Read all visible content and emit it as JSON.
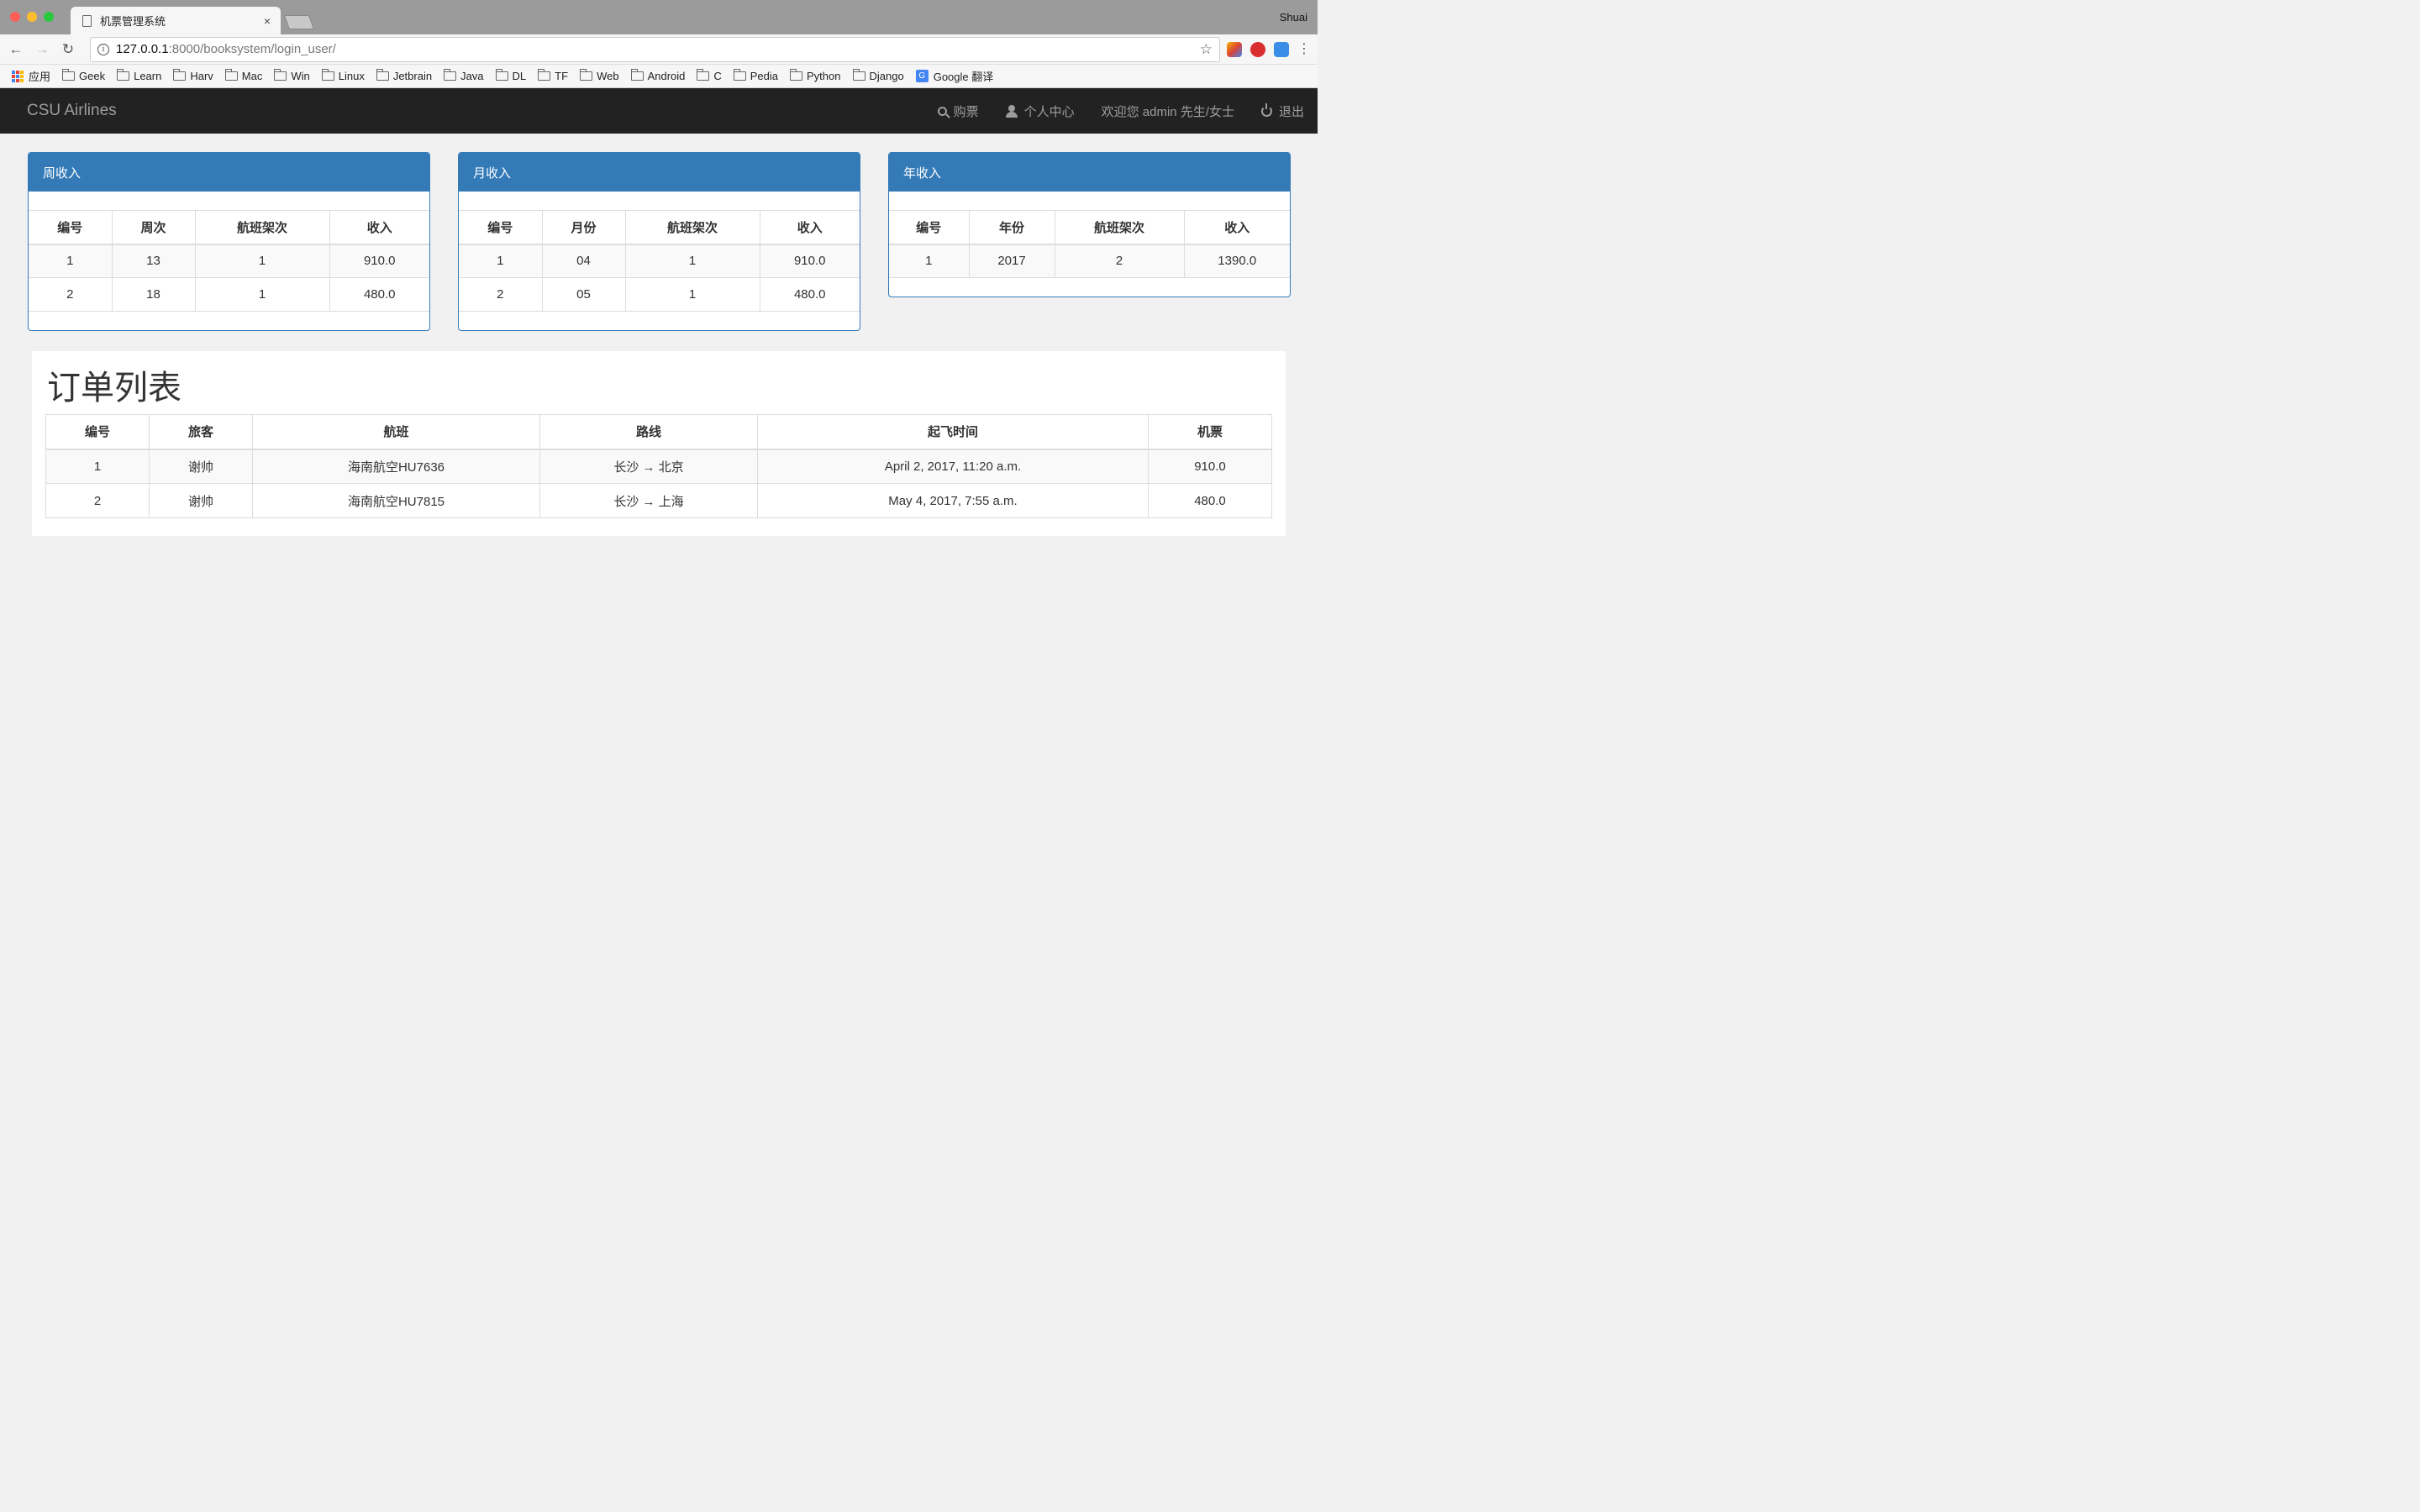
{
  "browser": {
    "tab_title": "机票管理系统",
    "tab_close": "×",
    "profile": "Shuai",
    "url_host": "127.0.0.1",
    "url_path": ":8000/booksystem/login_user/",
    "bookmarks": [
      "应用",
      "Geek",
      "Learn",
      "Harv",
      "Mac",
      "Win",
      "Linux",
      "Jetbrain",
      "Java",
      "DL",
      "TF",
      "Web",
      "Android",
      "C",
      "Pedia",
      "Python",
      "Django",
      "Google 翻译"
    ]
  },
  "nav": {
    "brand": "CSU Airlines",
    "buy": "购票",
    "profile": "个人中心",
    "welcome": "欢迎您 admin 先生/女士",
    "logout": "退出"
  },
  "panels": {
    "weekly": {
      "title": "周收入",
      "headers": [
        "编号",
        "周次",
        "航班架次",
        "收入"
      ],
      "rows": [
        [
          "1",
          "13",
          "1",
          "910.0"
        ],
        [
          "2",
          "18",
          "1",
          "480.0"
        ]
      ]
    },
    "monthly": {
      "title": "月收入",
      "headers": [
        "编号",
        "月份",
        "航班架次",
        "收入"
      ],
      "rows": [
        [
          "1",
          "04",
          "1",
          "910.0"
        ],
        [
          "2",
          "05",
          "1",
          "480.0"
        ]
      ]
    },
    "yearly": {
      "title": "年收入",
      "headers": [
        "编号",
        "年份",
        "航班架次",
        "收入"
      ],
      "rows": [
        [
          "1",
          "2017",
          "2",
          "1390.0"
        ]
      ]
    }
  },
  "orders": {
    "title": "订单列表",
    "headers": [
      "编号",
      "旅客",
      "航班",
      "路线",
      "起飞时间",
      "机票"
    ],
    "rows": [
      [
        "1",
        "谢帅",
        "海南航空HU7636",
        "长沙 → 北京",
        "April 2, 2017, 11:20 a.m.",
        "910.0"
      ],
      [
        "2",
        "谢帅",
        "海南航空HU7815",
        "长沙 → 上海",
        "May 4, 2017, 7:55 a.m.",
        "480.0"
      ]
    ]
  },
  "colors": {
    "primary": "#337ab7",
    "navbar": "#222222",
    "nav_text": "#9d9d9d"
  }
}
